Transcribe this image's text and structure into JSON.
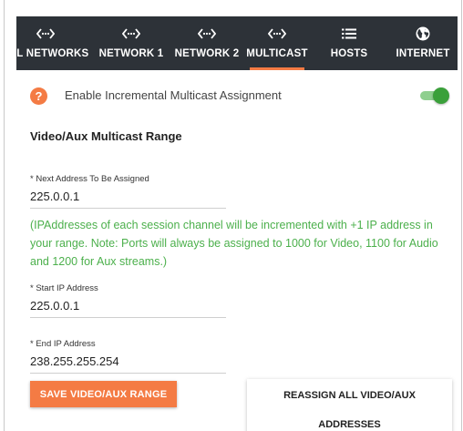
{
  "tabs": [
    {
      "label": "ALL NETWORKS",
      "icon": "network-icon"
    },
    {
      "label": "NETWORK 1",
      "icon": "network-icon"
    },
    {
      "label": "NETWORK 2",
      "icon": "network-icon"
    },
    {
      "label": "MULTICAST",
      "icon": "network-icon",
      "active": true
    },
    {
      "label": "HOSTS",
      "icon": "list-icon"
    },
    {
      "label": "INTERNET",
      "icon": "globe-icon"
    }
  ],
  "toggle": {
    "label": "Enable Incremental Multicast Assignment",
    "enabled": true
  },
  "section_title": "Video/Aux Multicast Range",
  "fields": {
    "next_address": {
      "label": "* Next Address To Be Assigned",
      "value": "225.0.0.1"
    },
    "start_ip": {
      "label": "* Start IP Address",
      "value": "225.0.0.1"
    },
    "end_ip": {
      "label": "* End IP Address",
      "value": "238.255.255.254"
    }
  },
  "note": "(IPAddresses of each session channel will be incremented with +1 IP address in your range. Note: Ports will always be assigned to 1000 for Video, 1100 for Audio and 1200 for Aux streams.)",
  "buttons": {
    "save": "SAVE VIDEO/AUX RANGE",
    "reassign_line1": "REASSIGN ALL VIDEO/AUX",
    "reassign_line2": "ADDRESSES"
  },
  "colors": {
    "accent": "#f47b44",
    "tabbar": "#2d3238",
    "note_green": "#4cb04c",
    "toggle_green": "#3aa03a"
  }
}
